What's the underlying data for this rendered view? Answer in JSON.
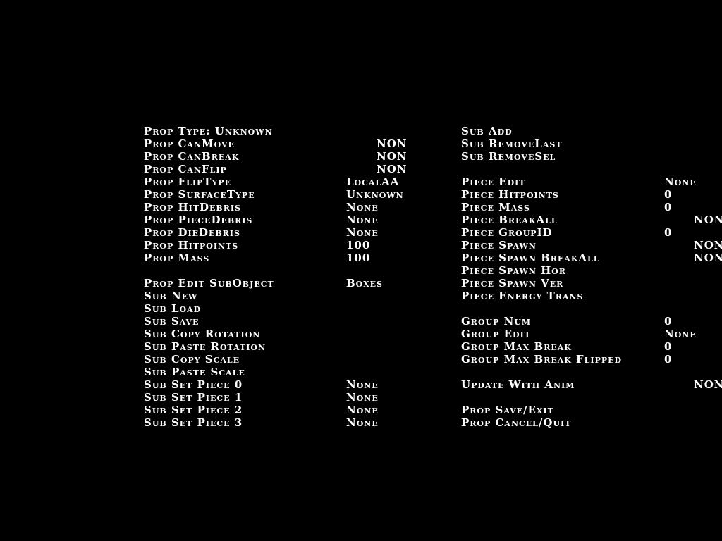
{
  "text_color": "#ffffff",
  "background_color": "#000000",
  "left_column": [
    {
      "label": "Prop Type: Unknown",
      "value": ""
    },
    {
      "label": "Prop CanMove",
      "value": "NON"
    },
    {
      "label": "Prop CanBreak",
      "value": "NON"
    },
    {
      "label": "Prop CanFlip",
      "value": "NON"
    },
    {
      "label": "Prop FlipType",
      "value": "LocalAA"
    },
    {
      "label": "Prop SurfaceType",
      "value": "Unknown"
    },
    {
      "label": "Prop HitDebris",
      "value": "None"
    },
    {
      "label": "Prop PieceDebris",
      "value": "None"
    },
    {
      "label": "Prop DieDebris",
      "value": "None"
    },
    {
      "label": "Prop Hitpoints",
      "value": "100"
    },
    {
      "label": "Prop Mass",
      "value": "100"
    },
    {
      "label": "Prop Edit SubObject",
      "value": "Boxes"
    },
    {
      "label": "Sub New",
      "value": ""
    },
    {
      "label": "Sub Load",
      "value": ""
    },
    {
      "label": "Sub Save",
      "value": ""
    },
    {
      "label": "Sub Copy Rotation",
      "value": ""
    },
    {
      "label": "Sub Paste Rotation",
      "value": ""
    },
    {
      "label": "Sub Copy Scale",
      "value": ""
    },
    {
      "label": "Sub Paste Scale",
      "value": ""
    },
    {
      "label": "Sub Set Piece 0",
      "value": "None"
    },
    {
      "label": "Sub Set Piece 1",
      "value": "None"
    },
    {
      "label": "Sub Set Piece 2",
      "value": "None"
    },
    {
      "label": "Sub Set Piece 3",
      "value": "None"
    }
  ],
  "right_column": [
    {
      "label": "Sub Add",
      "value": ""
    },
    {
      "label": "Sub RemoveLast",
      "value": ""
    },
    {
      "label": "Sub RemoveSel",
      "value": ""
    },
    {
      "label": "Piece Edit",
      "value": "None"
    },
    {
      "label": "Piece Hitpoints",
      "value": "0"
    },
    {
      "label": "Piece Mass",
      "value": "0"
    },
    {
      "label": "Piece BreakAll",
      "value": "NON"
    },
    {
      "label": "Piece GroupID",
      "value": "0"
    },
    {
      "label": "Piece Spawn",
      "value": "NON"
    },
    {
      "label": "Piece Spawn BreakAll",
      "value": "NON"
    },
    {
      "label": "Piece Spawn Hor",
      "value": ""
    },
    {
      "label": "Piece Spawn Ver",
      "value": ""
    },
    {
      "label": "Piece Energy Trans",
      "value": ""
    },
    {
      "label": "Group Num",
      "value": "0"
    },
    {
      "label": "Group Edit",
      "value": "None"
    },
    {
      "label": "Group Max Break",
      "value": "0"
    },
    {
      "label": "Group Max Break Flipped",
      "value": "0"
    },
    {
      "label": "Update With Anim",
      "value": "NON"
    },
    {
      "label": "Prop Save/Exit",
      "value": ""
    },
    {
      "label": "Prop Cancel/Quit",
      "value": ""
    }
  ]
}
